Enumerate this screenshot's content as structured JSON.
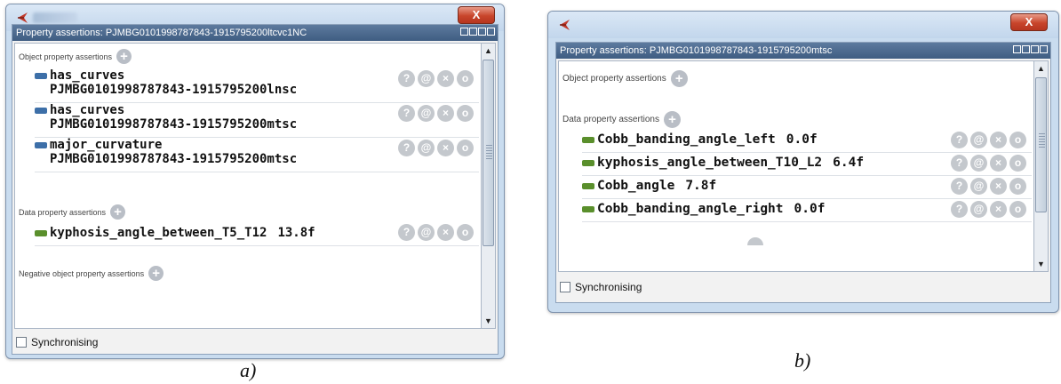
{
  "panels": [
    {
      "view_title": "Property assertions: PJMBG0101998787843-1915795200ltcvc1NC",
      "close_glyph": "X",
      "sections": [
        {
          "label": "Object property assertions",
          "rows": [
            {
              "property": "has_curves",
              "value": "PJMBG0101998787843-1915795200lnsc"
            },
            {
              "property": "has_curves",
              "value": "PJMBG0101998787843-1915795200mtsc"
            },
            {
              "property": "major_curvature",
              "value": "PJMBG0101998787843-1915795200mtsc"
            }
          ]
        },
        {
          "label": "Data property assertions",
          "rows": [
            {
              "property": "kyphosis_angle_between_T5_T12",
              "value": "13.8f"
            }
          ]
        },
        {
          "label": "Negative object property assertions",
          "rows": []
        }
      ],
      "sync_label": "Synchronising",
      "caption": "a)"
    },
    {
      "view_title": "Property assertions: PJMBG0101998787843-1915795200mtsc",
      "close_glyph": "X",
      "sections": [
        {
          "label": "Object property assertions",
          "rows": []
        },
        {
          "label": "Data property assertions",
          "rows": [
            {
              "property": "Cobb_banding_angle_left",
              "value": "0.0f"
            },
            {
              "property": "kyphosis_angle_between_T10_L2",
              "value": "6.4f"
            },
            {
              "property": "Cobb_angle",
              "value": "7.8f"
            },
            {
              "property": "Cobb_banding_angle_right",
              "value": "0.0f"
            }
          ]
        }
      ],
      "sync_label": "Synchronising",
      "caption": "b)"
    }
  ],
  "row_buttons": [
    "?",
    "@",
    "×",
    "o"
  ],
  "add_glyph": "+",
  "scroll_up": "▲",
  "scroll_down": "▼",
  "colors": {
    "object_property": "#3d6fa8",
    "data_property": "#5a8f2c",
    "view_header": "#4a6a90",
    "close_button": "#c8452b"
  }
}
